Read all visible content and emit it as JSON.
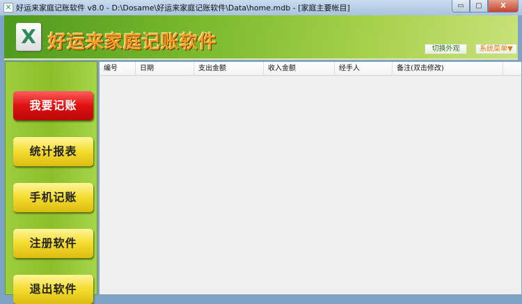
{
  "window": {
    "title": "好运来家庭记账软件 v8.0 - D:\\Dosame\\好运来家庭记账软件\\Data\\home.mdb - [家庭主要帐目]",
    "minimize": "▭",
    "maximize": "□",
    "close": "X"
  },
  "header": {
    "logo": "X",
    "app_title": "好运来家庭记账软件",
    "skin_button": "切换外观",
    "menu_button": "系统菜单▼"
  },
  "nav": [
    {
      "label": "我要记账"
    },
    {
      "label": "统计报表"
    },
    {
      "label": "手机记账"
    },
    {
      "label": "注册软件"
    },
    {
      "label": "退出软件"
    }
  ],
  "table": {
    "columns": [
      "编号",
      "日期",
      "支出金额",
      "收入金额",
      "经手人",
      "备注(双击修改)"
    ],
    "rows": []
  }
}
